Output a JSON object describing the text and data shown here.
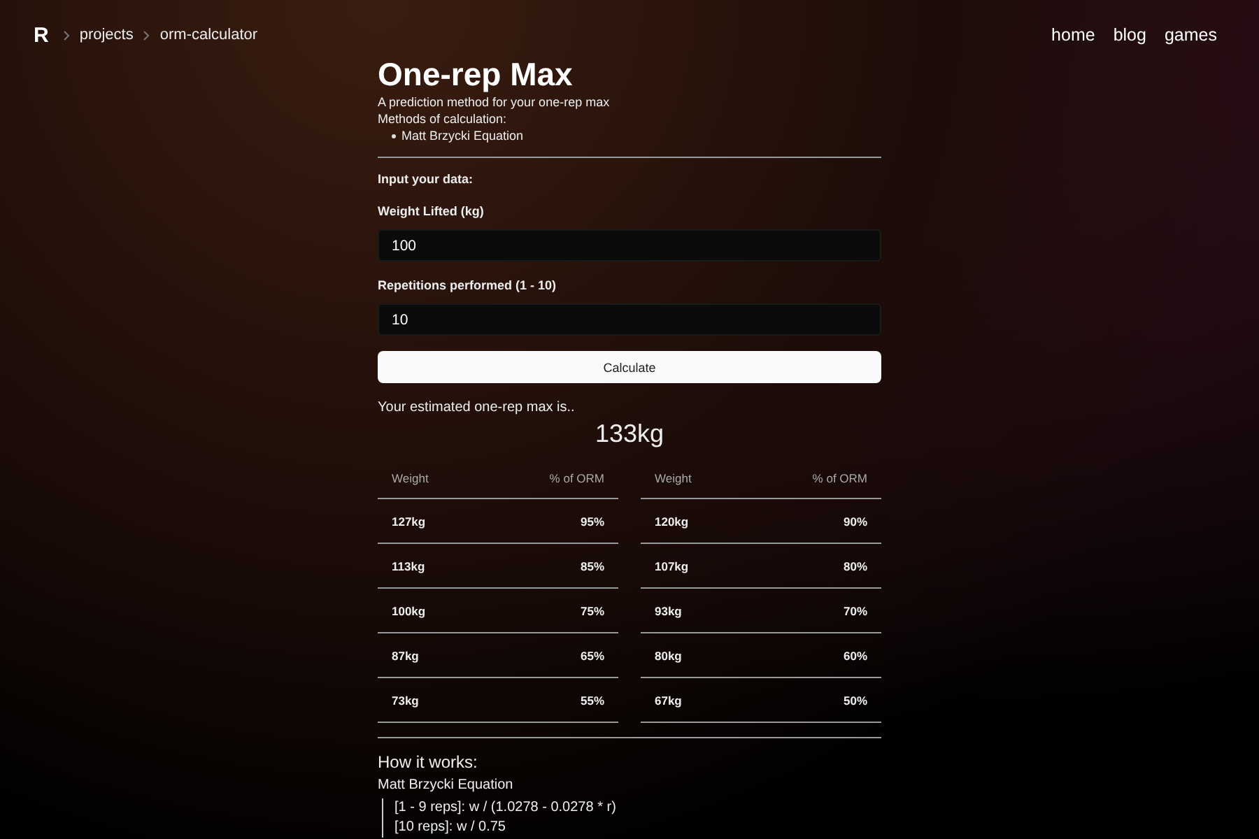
{
  "header": {
    "logo": "R",
    "breadcrumbs": [
      "projects",
      "orm-calculator"
    ],
    "nav": [
      "home",
      "blog",
      "games"
    ]
  },
  "title": "One-rep Max",
  "subtitle": "A prediction method for your one-rep max",
  "methods_label": "Methods of calculation:",
  "methods": [
    "Matt Brzycki Equation"
  ],
  "form": {
    "heading": "Input your data:",
    "fields": [
      {
        "label": "Weight Lifted (kg)",
        "value": "100"
      },
      {
        "label": "Repetitions performed (1 - 10)",
        "value": "10"
      }
    ],
    "button": "Calculate"
  },
  "result": {
    "label": "Your estimated one-rep max is..",
    "value": "133kg"
  },
  "tables": [
    {
      "columns": [
        "Weight",
        "% of ORM"
      ],
      "rows": [
        [
          "127kg",
          "95%"
        ],
        [
          "113kg",
          "85%"
        ],
        [
          "100kg",
          "75%"
        ],
        [
          "87kg",
          "65%"
        ],
        [
          "73kg",
          "55%"
        ]
      ]
    },
    {
      "columns": [
        "Weight",
        "% of ORM"
      ],
      "rows": [
        [
          "120kg",
          "90%"
        ],
        [
          "107kg",
          "80%"
        ],
        [
          "93kg",
          "70%"
        ],
        [
          "80kg",
          "60%"
        ],
        [
          "67kg",
          "50%"
        ]
      ]
    }
  ],
  "how": {
    "heading": "How it works:",
    "method": "Matt Brzycki Equation",
    "formulas": [
      "[1 - 9 reps]: w / (1.0278 - 0.0278 * r)",
      "[10 reps]: w / 0.75"
    ]
  }
}
